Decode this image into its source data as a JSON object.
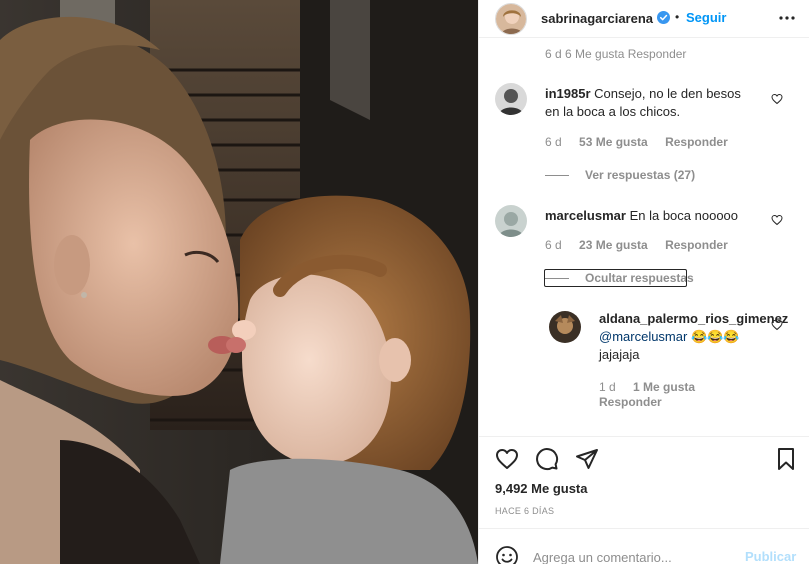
{
  "post": {
    "username": "sabrinagarciarena",
    "separator": "•",
    "follow_label": "Seguir",
    "likes_text": "9,492 Me gusta",
    "time_ago": "HACE 6 DÍAS"
  },
  "cut_comment": {
    "meta": "6 d    6 Me gusta    Responder"
  },
  "comments": [
    {
      "username": "in1985r",
      "text_line1": "Consejo, no le den besos",
      "text_line2": "en la boca a los chicos.",
      "time": "6 d",
      "likes": "53 Me gusta",
      "reply": "Responder",
      "replies_toggle": "Ver respuestas (27)"
    },
    {
      "username": "marcelusmar",
      "text": "En la boca nooooo",
      "time": "6 d",
      "likes": "23 Me gusta",
      "reply": "Responder",
      "replies_toggle": "Ocultar respuestas"
    }
  ],
  "reply": {
    "username": "aldana_palermo_rios_gimenez",
    "mention": "@marcelusmar",
    "emojis": "😂😂😂",
    "text": "jajajaja",
    "time": "1 d",
    "likes": "1 Me gusta",
    "reply": "Responder"
  },
  "composer": {
    "placeholder": "Agrega un comentario...",
    "publish_label": "Publicar"
  },
  "icons": {
    "like": "heart-icon",
    "comment": "comment-icon",
    "share": "paper-plane-icon",
    "save": "bookmark-icon",
    "emoji": "smiley-icon",
    "more": "more-options-icon",
    "verified": "verified-badge-icon"
  },
  "colors": {
    "link_blue": "#0095f6",
    "verified_blue": "#3897f0",
    "muted_text": "#8e8e8e",
    "publish_disabled": "#b2dffc"
  }
}
